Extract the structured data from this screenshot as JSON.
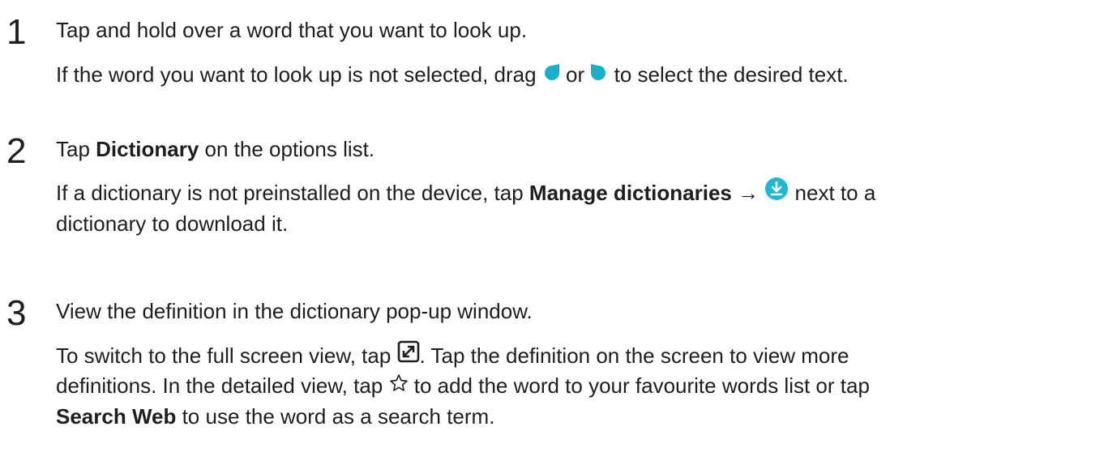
{
  "steps": [
    {
      "number": "1",
      "title": "Tap and hold over a word that you want to look up.",
      "desc": {
        "a": "If the word you want to look up is not selected, drag ",
        "b": " or ",
        "c": " to select the desired text."
      }
    },
    {
      "number": "2",
      "title": {
        "a": "Tap ",
        "b_bold": "Dictionary",
        "c": " on the options list."
      },
      "desc": {
        "line1_a": "If a dictionary is not preinstalled on the device, tap ",
        "line1_bold": "Manage dictionaries",
        "line1_arrow": " → ",
        "line1_c": " next to a",
        "line2": "dictionary to download it."
      }
    },
    {
      "number": "3",
      "title": "View the definition in the dictionary pop-up window.",
      "desc": {
        "line1_a": "To switch to the full screen view, tap ",
        "line1_b": ". Tap the definition on the screen to view more",
        "line2_a": "definitions. In the detailed view, tap ",
        "line2_b": " to add the word to your favourite words list or tap",
        "line3_bold": "Search Web",
        "line3_b": " to use the word as a search term."
      }
    }
  ],
  "icons": {
    "left_handle": "left-selection-handle-icon",
    "right_handle": "right-selection-handle-icon",
    "download": "download-icon",
    "fullscreen": "fullscreen-icon",
    "star": "star-outline-icon"
  },
  "colors": {
    "text": "#1e1e1e",
    "handle": "#1ab0cc",
    "download": "#20b7d4"
  }
}
